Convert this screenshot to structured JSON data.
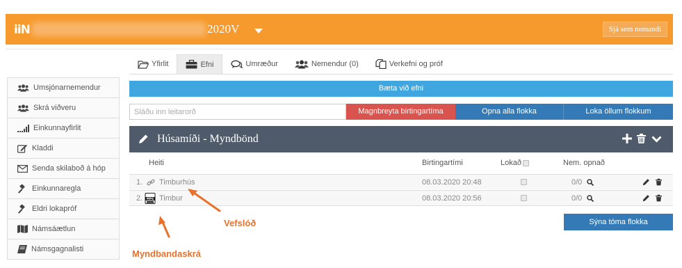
{
  "header": {
    "logo_text": "iiN",
    "course_code": "2020V",
    "student_view_label": "Sjá sem nemandi",
    "accent_color": "#f79a2d"
  },
  "tabs": [
    {
      "label": "Yfirlit",
      "icon": "folder-open-icon"
    },
    {
      "label": "Efni",
      "icon": "briefcase-icon",
      "active": true
    },
    {
      "label": "Umræður",
      "icon": "comments-icon"
    },
    {
      "label": "Nemendur (0)",
      "icon": "users-icon"
    },
    {
      "label": "Verkefni og próf",
      "icon": "copy-icon"
    }
  ],
  "sidebar": {
    "items": [
      {
        "label": "Umsjónarnemendur",
        "icon": "users-icon"
      },
      {
        "label": "Skrá viðveru",
        "icon": "users-icon"
      },
      {
        "label": "Einkunnayfirlit",
        "icon": "signal-bars-icon"
      },
      {
        "label": "Kladdi",
        "icon": "edit-icon"
      },
      {
        "label": "Senda skilaboð á hóp",
        "icon": "envelope-icon"
      },
      {
        "label": "Einkunnaregla",
        "icon": "gavel-icon"
      },
      {
        "label": "Eldri lokapróf",
        "icon": "gavel-icon"
      },
      {
        "label": "Námsáætlun",
        "icon": "map-icon"
      },
      {
        "label": "Námsgagnalisti",
        "icon": "book-icon"
      }
    ]
  },
  "main": {
    "add_content_label": "Bæta við efni",
    "search_placeholder": "Sláðu inn leitarorð",
    "bulk_change_label": "Magnbreyta birtingartíma",
    "open_all_label": "Opna alla flokka",
    "close_all_label": "Loka öllum flokkum",
    "show_empty_label": "Sýna tóma flokka"
  },
  "folder": {
    "title": "Húsamíði - Myndbönd",
    "columns": {
      "name": "Heiti",
      "publish_time": "Birtingartími",
      "locked": "Lokað",
      "student_opened": "Nem. opnað"
    },
    "rows": [
      {
        "index": "1.",
        "type_icon": "link-icon",
        "name": "Timburhús",
        "publish_time": "08.03.2020 20:48",
        "opened": "0/0"
      },
      {
        "index": "2.",
        "type_icon": "mp4-file-icon",
        "name": "Timbur",
        "publish_time": "08.03.2020 20:56",
        "opened": "0/0"
      }
    ]
  },
  "annotations": {
    "web_link": "Vefslóð",
    "video_file": "Myndbandaskrá",
    "color": "#e8712b"
  }
}
